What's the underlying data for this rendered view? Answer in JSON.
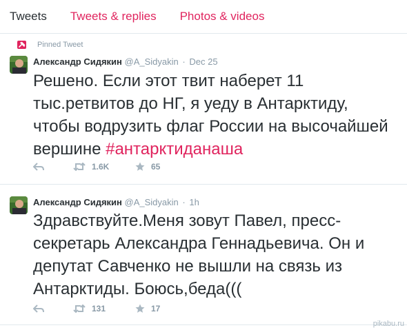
{
  "tabs": [
    {
      "label": "Tweets"
    },
    {
      "label": "Tweets & replies"
    },
    {
      "label": "Photos & videos"
    }
  ],
  "tweets": [
    {
      "pinned_label": "Pinned Tweet",
      "author_name": "Александр Сидякин",
      "handle": "@A_Sidyakin",
      "time": "Dec 25",
      "text": "Решено. Если этот твит наберет 11 тыс.ретвитов до НГ, я уеду в Антарктиду, чтобы водрузить флаг России на высочайшей вершине ",
      "hashtag": "#антарктиданаша",
      "retweets": "1.6K",
      "favorites": "65"
    },
    {
      "author_name": "Александр Сидякин",
      "handle": "@A_Sidyakin",
      "time": "1h",
      "text": "Здравствуйте.Меня зовут Павел, пресс-секретарь Александра Геннадьевича. Он и депутат Савченко не вышли на связь из Антарктиды. Боюсь,беда(((",
      "retweets": "131",
      "favorites": "17"
    }
  ],
  "separator": "·",
  "watermark": "pikabu.ru",
  "colors": {
    "accent": "#e0245e",
    "muted": "#8899a6",
    "text": "#292f33",
    "divider": "#e1e8ed"
  }
}
